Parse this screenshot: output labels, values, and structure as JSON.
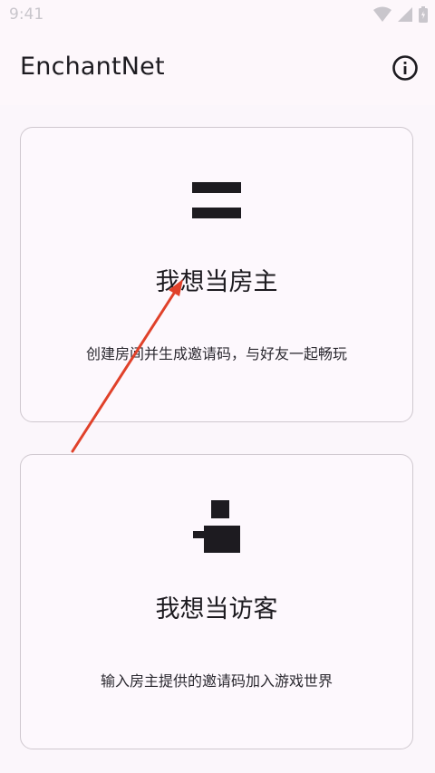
{
  "status_bar": {
    "time": "9:41"
  },
  "app_bar": {
    "title": "EnchantNet"
  },
  "cards": {
    "host": {
      "title": "我想当房主",
      "description": "创建房间并生成邀请码，与好友一起畅玩"
    },
    "guest": {
      "title": "我想当访客",
      "description": "输入房主提供的邀请码加入游戏世界"
    }
  },
  "icons": {
    "info": "info-icon",
    "host": "equals-icon",
    "guest": "person-icon",
    "wifi": "wifi-icon",
    "signal": "signal-icon",
    "battery": "battery-icon"
  },
  "colors": {
    "background": "#fdf7fb",
    "card_border": "#cfc8cf",
    "text": "#1d1b20",
    "arrow": "#e0412a"
  }
}
